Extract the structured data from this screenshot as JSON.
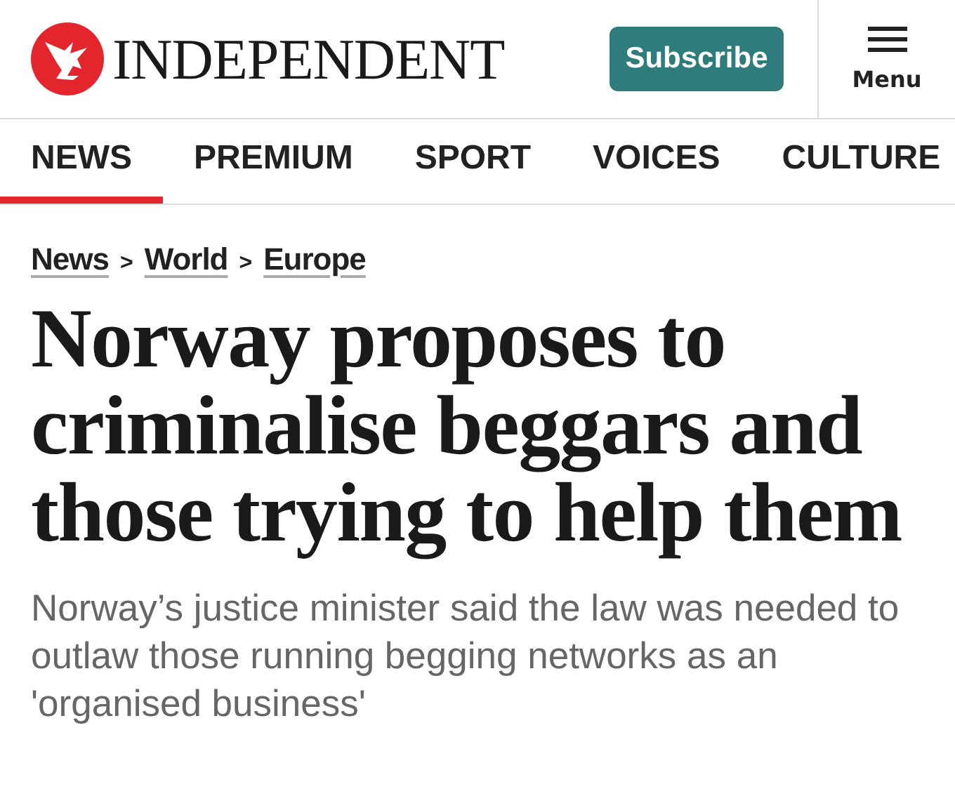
{
  "header": {
    "wordmark": "INDEPENDENT",
    "subscribe_button": "Subscribe",
    "menu_label": "Menu"
  },
  "nav": [
    {
      "label": "NEWS",
      "selected": true
    },
    {
      "label": "PREMIUM",
      "selected": false
    },
    {
      "label": "SPORT",
      "selected": false
    },
    {
      "label": "VOICES",
      "selected": false
    },
    {
      "label": "CULTURE",
      "selected": false
    }
  ],
  "breadcrumbs": [
    "News",
    "World",
    "Europe"
  ],
  "breadcrumb_separator": ">",
  "headline": "Norway proposes to criminalise beggars and those trying to help them",
  "standfirst": "Norway’s justice minister said the law was needed to outlaw those running begging networks as an 'organised business'"
}
